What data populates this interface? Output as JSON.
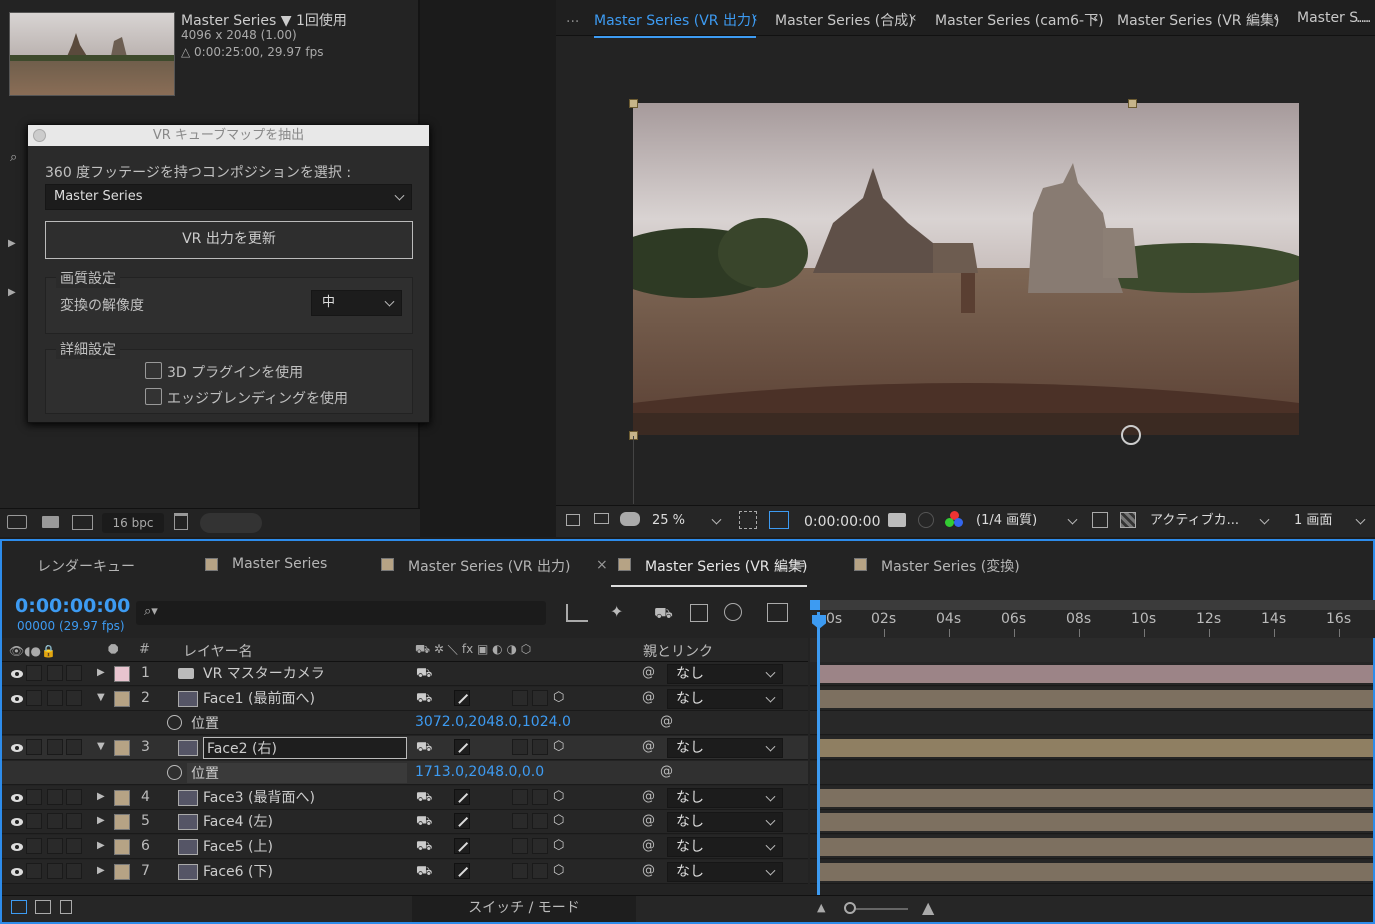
{
  "project": {
    "name": "Master Series",
    "name_suffix": "▼ 1回使用",
    "dims": "4096 x 2048 (1.00)",
    "duration": "△ 0:00:25:00, 29.97 fps",
    "bpc": "16 bpc"
  },
  "dialog": {
    "title": "VR キューブマップを抽出",
    "select_label": "360 度フッテージを持つコンポジションを選択 :",
    "comp_value": "Master Series",
    "update_button": "VR 出力を更新",
    "quality_group": "画質設定",
    "resolution_label": "変換の解像度",
    "resolution_value": "中",
    "detail_group": "詳細設定",
    "cb_3d": "3D プラグインを使用",
    "cb_edge": "エッジブレンディングを使用"
  },
  "viewer": {
    "tabs": [
      "...",
      "Master Series (VR 出力)",
      "Master Series (合成)",
      "Master Series (cam6-下)",
      "Master Series (VR 編集)",
      "Master S...",
      "..."
    ],
    "zoom": "25 %",
    "timecode": "0:00:00:00",
    "resolution": "(1/4 画質)",
    "camera": "アクティブカ...",
    "views": "1 画面"
  },
  "timeline": {
    "tabs": [
      "レンダーキュー",
      "Master Series",
      "Master Series (VR 出力)",
      "Master Series (VR 編集)",
      "Master Series (変換)"
    ],
    "close": "×",
    "menu": "≡",
    "timecode": "0:00:00:00",
    "fps": "00000 (29.97 fps)",
    "col_num": "#",
    "col_name": "レイヤー名",
    "col_parent": "親とリンク",
    "ruler": [
      "0s",
      "02s",
      "04s",
      "06s",
      "08s",
      "10s",
      "12s",
      "14s",
      "16s"
    ],
    "footer": "スイッチ / モード",
    "layers": [
      {
        "n": "1",
        "name": "VR マスターカメラ",
        "parent": "なし",
        "twirl": "▶",
        "color": "#e8c4cf"
      },
      {
        "n": "2",
        "name": "Face1 (最前面へ)",
        "parent": "なし",
        "twirl": "▼",
        "color": "#b6a385"
      },
      {
        "prop": "位置",
        "value": "3072.0,2048.0,1024.0"
      },
      {
        "n": "3",
        "name": "Face2 (右)",
        "parent": "なし",
        "twirl": "▼",
        "color": "#b6a385"
      },
      {
        "prop": "位置",
        "value": "1713.0,2048.0,0.0"
      },
      {
        "n": "4",
        "name": "Face3 (最背面へ)",
        "parent": "なし",
        "twirl": "▶",
        "color": "#b6a385"
      },
      {
        "n": "5",
        "name": "Face4 (左)",
        "parent": "なし",
        "twirl": "▶",
        "color": "#b6a385"
      },
      {
        "n": "6",
        "name": "Face5 (上)",
        "parent": "なし",
        "twirl": "▶",
        "color": "#b6a385"
      },
      {
        "n": "7",
        "name": "Face6 (下)",
        "parent": "なし",
        "twirl": "▶",
        "color": "#b6a385"
      }
    ]
  }
}
